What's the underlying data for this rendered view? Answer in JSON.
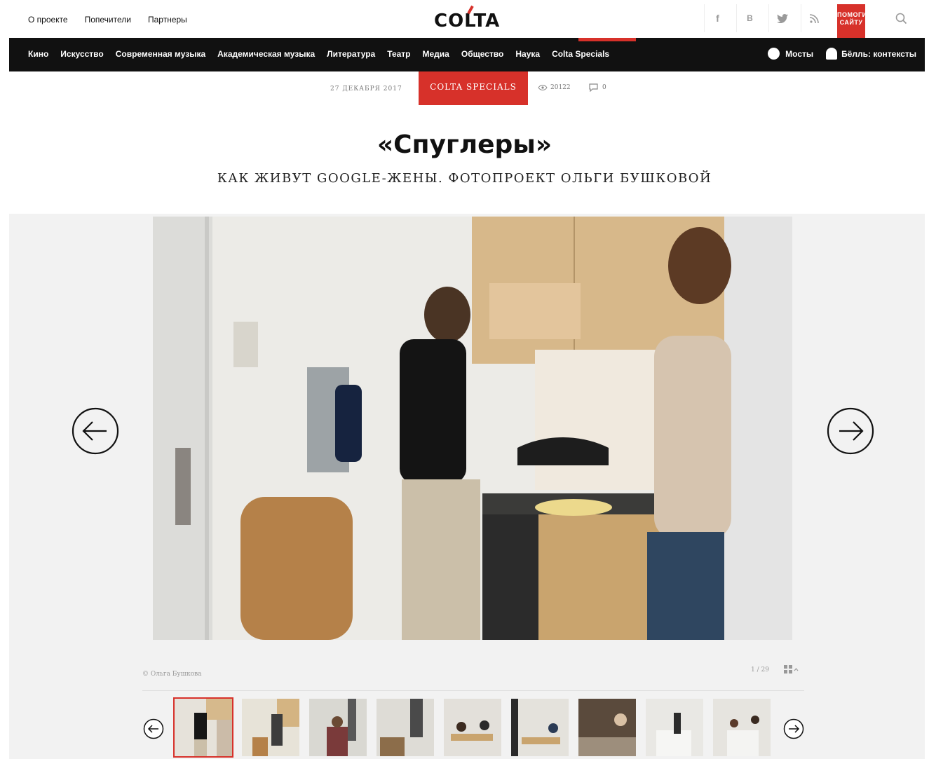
{
  "top": {
    "links": [
      "О проекте",
      "Попечители",
      "Партнеры"
    ],
    "logo": "COLTA",
    "social": [
      "f",
      "В",
      "t",
      "rss"
    ],
    "donate_line1": "ПОМОГИ",
    "donate_line2": "САЙТУ"
  },
  "nav": {
    "items": [
      "Кино",
      "Искусство",
      "Современная музыка",
      "Академическая музыка",
      "Литература",
      "Театр",
      "Медиа",
      "Общество",
      "Наука",
      "Colta Specials"
    ],
    "active": "Colta Specials",
    "right_items": [
      "Мосты",
      "Бёлль: контексты"
    ]
  },
  "article": {
    "date": "27 ДЕКАБРЯ 2017",
    "category": "COLTA SPECIALS",
    "views": "20122",
    "comments": "0",
    "title": "«Спуглеры»",
    "subtitle": "КАК ЖИВУТ GOOGLE-ЖЕНЫ. ФОТОПРОЕКТ ОЛЬГИ БУШКОВОЙ"
  },
  "gallery": {
    "credit": "© Ольга Бушкова",
    "counter": "1 / 29",
    "thumbnails_visible": 9,
    "selected_index": 0
  },
  "colors": {
    "accent": "#d7312a",
    "nav_bg": "#111111",
    "gallery_bg": "#f2f2f2"
  }
}
